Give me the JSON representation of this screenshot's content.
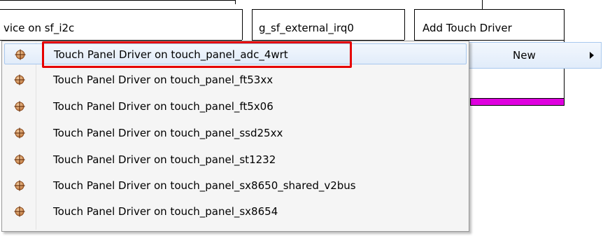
{
  "blocks": {
    "block1_label": "vice on sf_i2c",
    "block2_label": "g_sf_external_irq0",
    "block3_label": "Add Touch Driver"
  },
  "context_menu": {
    "items": [
      {
        "label": "Touch Panel Driver on touch_panel_adc_4wrt",
        "icon": "component-icon"
      },
      {
        "label": "Touch Panel Driver on touch_panel_ft53xx",
        "icon": "component-icon"
      },
      {
        "label": "Touch Panel Driver on touch_panel_ft5x06",
        "icon": "component-icon"
      },
      {
        "label": "Touch Panel Driver on touch_panel_ssd25xx",
        "icon": "component-icon"
      },
      {
        "label": "Touch Panel Driver on touch_panel_st1232",
        "icon": "component-icon"
      },
      {
        "label": "Touch Panel Driver on touch_panel_sx8650_shared_v2bus",
        "icon": "component-icon"
      },
      {
        "label": "Touch Panel Driver on touch_panel_sx8654",
        "icon": "component-icon"
      }
    ]
  },
  "submenu": {
    "new_label": "New",
    "arrow_icon": "chevron-right-icon"
  },
  "colors": {
    "highlight_border": "#e60000",
    "connector_bar": "#e000e0",
    "hover_bg": "#e1ecfa"
  }
}
